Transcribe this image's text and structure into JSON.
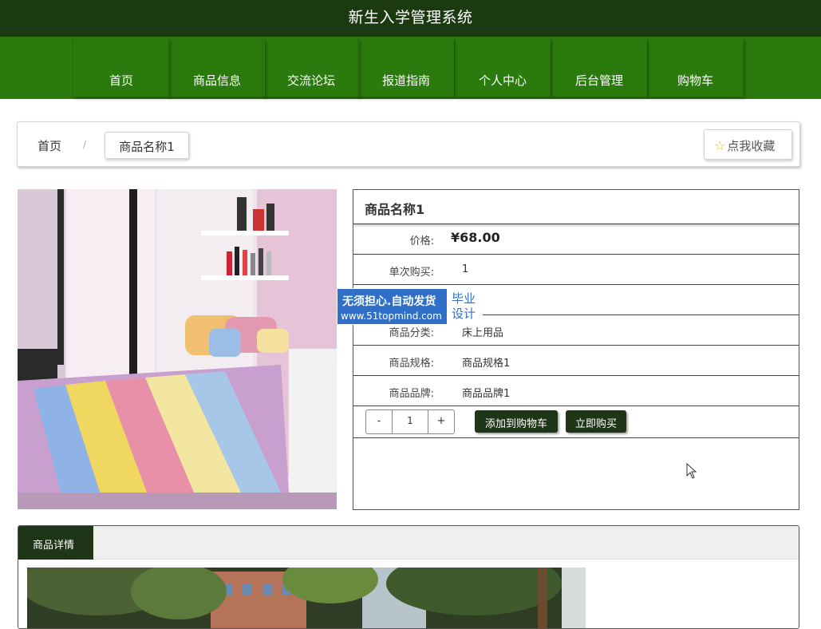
{
  "app": {
    "title": "新生入学管理系统"
  },
  "nav": {
    "items": [
      {
        "label": "首页"
      },
      {
        "label": "商品信息"
      },
      {
        "label": "交流论坛"
      },
      {
        "label": "报道指南"
      },
      {
        "label": "个人中心"
      },
      {
        "label": "后台管理"
      },
      {
        "label": "购物车"
      }
    ]
  },
  "breadcrumb": {
    "home": "首页",
    "separator": "/",
    "current": "商品名称1"
  },
  "favorite": {
    "label": "点我收藏"
  },
  "product": {
    "name": "商品名称1",
    "rows": {
      "price": {
        "label": "价格:",
        "value": "¥68.00"
      },
      "single_buy": {
        "label": "单次购买:",
        "value": "1"
      },
      "category": {
        "label": "商品分类:",
        "value": "床上用品"
      },
      "spec": {
        "label": "商品规格:",
        "value": "商品规格1"
      },
      "brand": {
        "label": "商品品牌:",
        "value": "商品品牌1"
      }
    },
    "stepper": {
      "minus": "-",
      "quantity": "1",
      "plus": "+"
    },
    "add_to_cart": "添加到购物车",
    "buy_now": "立即购买"
  },
  "watermark": {
    "line1": "无须担心.自动发货",
    "line2": "www.51topmind.com",
    "badge1": "毕业",
    "badge2": "设计"
  },
  "detail": {
    "tab": "商品详情"
  },
  "colors": {
    "topbar": "#1c3a12",
    "navbar": "#2a7a0d",
    "button_dark": "#1e3518",
    "watermark": "#2f6fc8"
  }
}
